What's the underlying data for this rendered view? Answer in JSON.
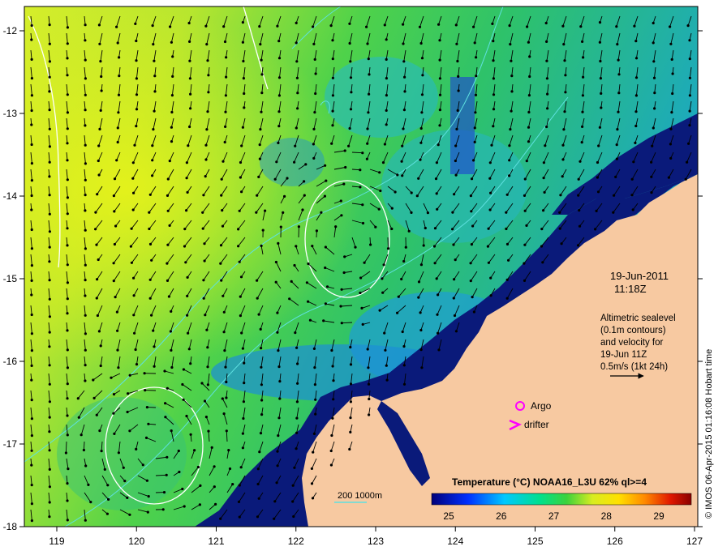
{
  "map": {
    "date": "19-Jun-2011",
    "time": "11:18Z",
    "altimetry_note": [
      "Altimetric sealevel",
      "(0.1m contours)",
      "and velocity for",
      "19-Jun 11Z",
      "0.5m/s (1kt 24h)"
    ],
    "markers": {
      "argo_label": "Argo",
      "drifter_label": "drifter"
    },
    "bathymetry_label": "200  1000m",
    "credit": "© IMOS 06-Apr-2015 01:16:08 Hobart time",
    "colorbar": {
      "title": "Temperature (°C) NOAA16_L3U 62% ql>=4",
      "ticks": [
        "25",
        "26",
        "27",
        "28",
        "29"
      ]
    },
    "axes": {
      "x_ticks": [
        "119",
        "120",
        "121",
        "122",
        "123",
        "124",
        "125",
        "126",
        "127"
      ],
      "y_ticks": [
        "-12",
        "-13",
        "-14",
        "-15",
        "-16",
        "-17",
        "-18"
      ]
    },
    "colors": {
      "land": "#f7c9a1",
      "deep_water": "#0a1a7a",
      "marker": "#ff00ff",
      "contour": "#ffffff",
      "bathy": "#5fe0e0"
    }
  }
}
